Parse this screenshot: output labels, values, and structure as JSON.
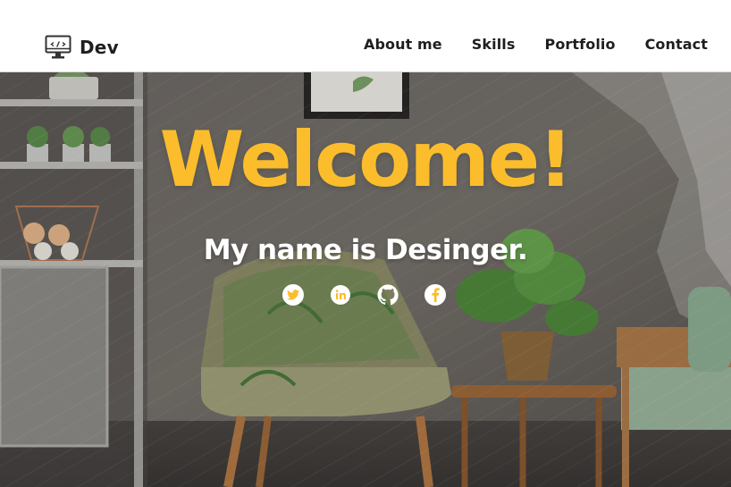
{
  "brand": {
    "name": "Dev",
    "icon": "monitor-code-icon"
  },
  "nav": {
    "items": [
      {
        "label": "About me"
      },
      {
        "label": "Skills"
      },
      {
        "label": "Portfolio"
      },
      {
        "label": "Contact"
      }
    ]
  },
  "hero": {
    "title": "Welcome!",
    "subtitle": "My name is Desinger.",
    "title_color": "#fbbd2b",
    "subtitle_color": "#ffffff"
  },
  "socials": [
    {
      "icon": "twitter-icon"
    },
    {
      "icon": "linkedin-icon"
    },
    {
      "icon": "github-icon"
    },
    {
      "icon": "facebook-icon"
    }
  ]
}
